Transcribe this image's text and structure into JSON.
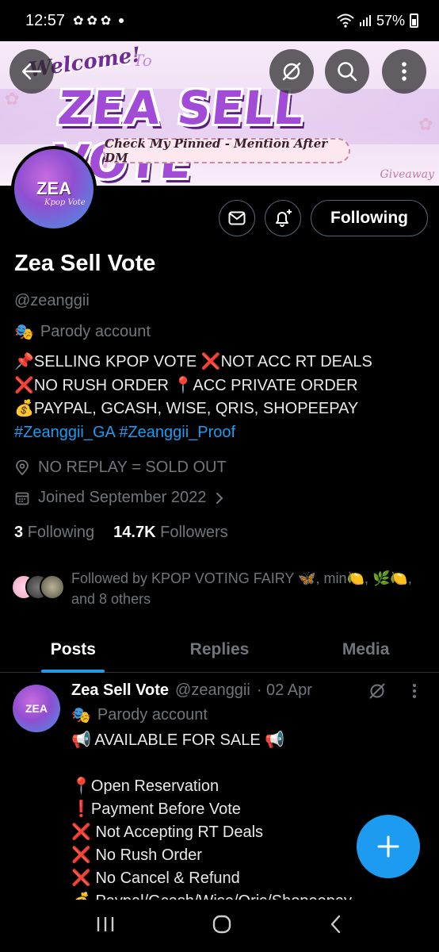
{
  "status_bar": {
    "time": "12:57",
    "battery": "57%"
  },
  "banner": {
    "welcome": "Welcome!",
    "to": "To",
    "title": "ZEA SELL VOTE",
    "subtitle": "Check My Pinned - Mention After DM",
    "giveaway": "Giveaway"
  },
  "avatar": {
    "text": "ZEA",
    "subtext": "Kpop Vote"
  },
  "profile": {
    "following_button": "Following",
    "name": "Zea Sell Vote",
    "handle": "@zeanggii",
    "parody_label": "Parody account",
    "bio_line1": "📌SELLING KPOP VOTE  ❌NOT ACC RT DEALS",
    "bio_line2": "❌NO RUSH ORDER  📍ACC PRIVATE ORDER",
    "bio_line3": "💰PAYPAL, GCASH, WISE, QRIS, SHOPEEPAY",
    "hashtag1": "#Zeanggii_GA",
    "hashtag2": "#Zeanggii_Proof",
    "location": "NO REPLAY = SOLD OUT",
    "joined": "Joined September 2022",
    "following_count": "3",
    "following_label": "Following",
    "followers_count": "14.7K",
    "followers_label": "Followers",
    "followed_by": "Followed by KPOP VOTING FAIRY 🦋, min🍋, 🌿🍋, and 8 others"
  },
  "tabs": [
    {
      "label": "Posts",
      "active": true
    },
    {
      "label": "Replies",
      "active": false
    },
    {
      "label": "Media",
      "active": false
    }
  ],
  "post": {
    "name": "Zea Sell Vote",
    "handle": "@zeanggii",
    "date": "· 02 Apr",
    "parody_label": "Parody account",
    "avatar_text": "ZEA",
    "body": "📢 AVAILABLE FOR SALE 📢\n\n📍Open Reservation\n❗Payment Before Vote\n❌ Not Accepting RT Deals\n❌ No Rush Order\n❌ No Cancel & Refund\n💰 Paypal/Gcash/Wise/Qris/Shopeepay"
  },
  "colors": {
    "accent": "#1d9bf0",
    "muted": "#71767b",
    "background": "#000000"
  }
}
